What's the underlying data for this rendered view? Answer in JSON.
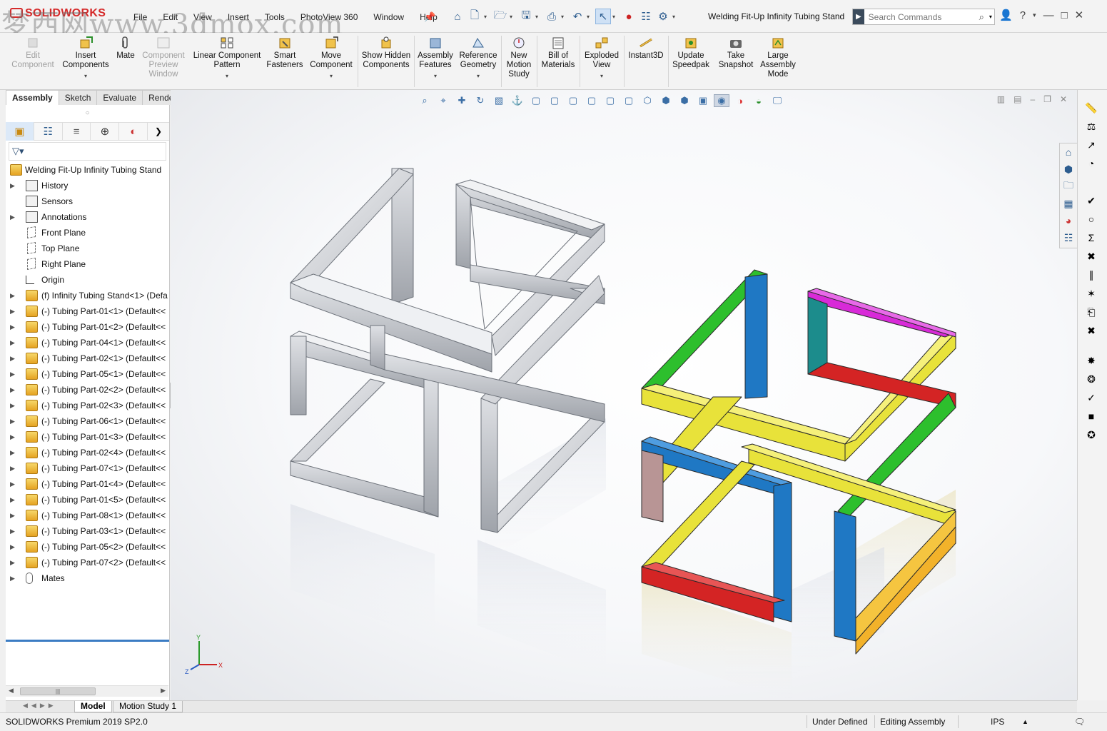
{
  "watermark": "梦西网www.3dmox.com",
  "app": {
    "brand": "SOLIDWORKS",
    "doc_title": "Welding Fit-Up Infinity Tubing Stand"
  },
  "menu": [
    "File",
    "Edit",
    "View",
    "Insert",
    "Tools",
    "PhotoView 360",
    "Window",
    "Help"
  ],
  "search": {
    "placeholder": "Search Commands"
  },
  "ribbon": {
    "edit_component": "Edit Component",
    "insert_components": "Insert Components",
    "mate": "Mate",
    "component_preview_window": "Component Preview Window",
    "linear_component_pattern": "Linear Component Pattern",
    "smart_fasteners": "Smart Fasteners",
    "move_component": "Move Component",
    "show_hidden_components": "Show Hidden Components",
    "assembly_features": "Assembly Features",
    "reference_geometry": "Reference Geometry",
    "new_motion_study": "New Motion Study",
    "bill_of_materials": "Bill of Materials",
    "exploded_view": "Exploded View",
    "instant3d": "Instant3D",
    "update_speedpak": "Update Speedpak",
    "take_snapshot": "Take Snapshot",
    "large_assembly_mode": "Large Assembly Mode"
  },
  "command_tabs": [
    "Assembly",
    "Sketch",
    "Evaluate",
    "Render Tools"
  ],
  "tree": {
    "root": "Welding Fit-Up Infinity Tubing Stand",
    "items": [
      "History",
      "Sensors",
      "Annotations",
      "Front Plane",
      "Top Plane",
      "Right Plane",
      "Origin",
      "(f) Infinity Tubing Stand<1> (Defa",
      "(-) Tubing Part-01<1> (Default<<",
      "(-) Tubing Part-01<2> (Default<<",
      "(-) Tubing Part-04<1> (Default<<",
      "(-) Tubing Part-02<1> (Default<<",
      "(-) Tubing Part-05<1> (Default<<",
      "(-) Tubing Part-02<2> (Default<<",
      "(-) Tubing Part-02<3> (Default<<",
      "(-) Tubing Part-06<1> (Default<<",
      "(-) Tubing Part-01<3> (Default<<",
      "(-) Tubing Part-02<4> (Default<<",
      "(-) Tubing Part-07<1> (Default<<",
      "(-) Tubing Part-01<4> (Default<<",
      "(-) Tubing Part-01<5> (Default<<",
      "(-) Tubing Part-08<1> (Default<<",
      "(-) Tubing Part-03<1> (Default<<",
      "(-) Tubing Part-05<2> (Default<<",
      "(-) Tubing Part-07<2> (Default<<",
      "Mates"
    ]
  },
  "triad": {
    "x": "X",
    "y": "Y",
    "z": "Z"
  },
  "bottom_tabs": [
    "Model",
    "Motion Study 1"
  ],
  "status": {
    "product": "SOLIDWORKS Premium 2019 SP2.0",
    "state": "Under Defined",
    "mode": "Editing Assembly",
    "units": "IPS"
  },
  "colors": {
    "steel": "#c9ccd1",
    "green": "#2dbf2d",
    "blue": "#1f78c4",
    "yellow": "#e8e23a",
    "magenta": "#d82ad8",
    "red": "#d42424",
    "teal": "#1c8c8c",
    "orange": "#f2b22a",
    "pink": "#b89595",
    "accent": "#3b7cc3"
  }
}
